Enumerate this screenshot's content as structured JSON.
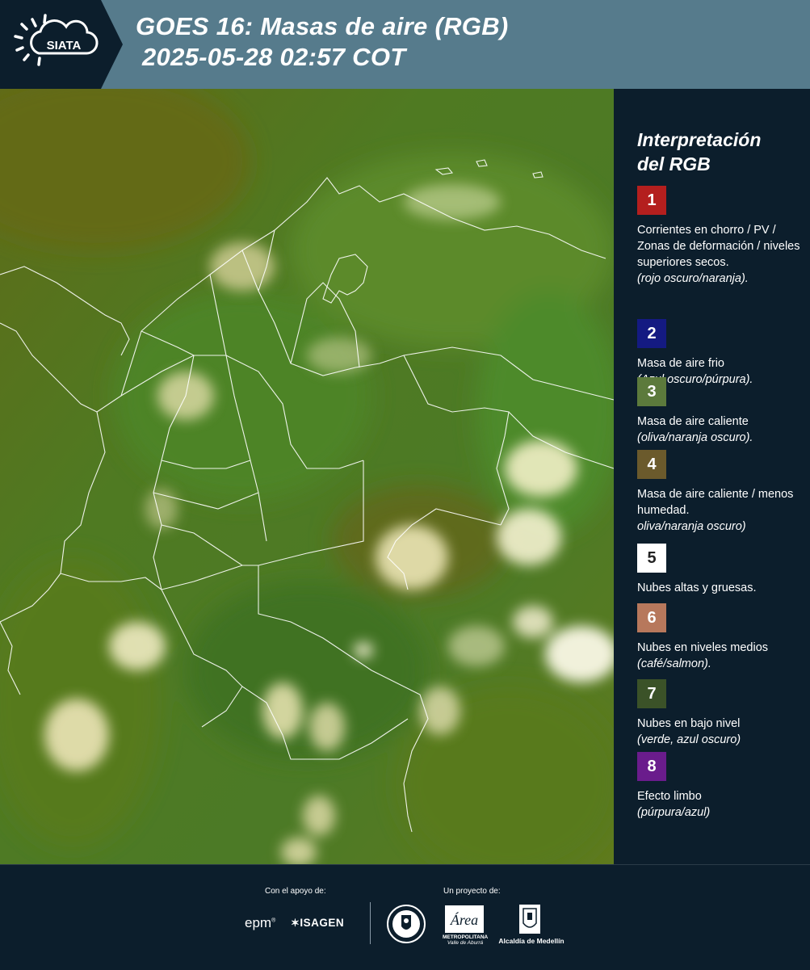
{
  "header": {
    "logo_text": "SIATA",
    "title_line1": "GOES 16: Masas de aire (RGB)",
    "title_line2": "2025-05-28 02:57 COT",
    "background_color": "#567b8c"
  },
  "legend": {
    "title_line1": "Interpretación",
    "title_line2": "del RGB",
    "items": [
      {
        "number": "1",
        "color": "#b41f1e",
        "text": "Corrientes en chorro / PV / Zonas de deformación / niveles superiores secos.",
        "note": "(rojo oscuro/naranja)."
      },
      {
        "number": "2",
        "color": "#141a82",
        "text": "Masa de aire frio",
        "note": "(Azul oscuro/púrpura)."
      },
      {
        "number": "3",
        "color": "#5c7a3c",
        "text": "Masa de aire caliente",
        "note": "(oliva/naranja oscuro)."
      },
      {
        "number": "4",
        "color": "#6b5a2c",
        "text": "Masa de aire caliente / menos humedad.",
        "note": "oliva/naranja oscuro)"
      },
      {
        "number": "5",
        "color": "#ffffff",
        "text": "Nubes altas y gruesas.",
        "note": ""
      },
      {
        "number": "6",
        "color": "#b7785c",
        "text": "Nubes en niveles medios",
        "note": "(café/salmon)."
      },
      {
        "number": "7",
        "color": "#3b5228",
        "text": "Nubes en bajo nivel",
        "note": "(verde, azul oscuro)"
      },
      {
        "number": "8",
        "color": "#6a1c8c",
        "text": "Efecto limbo",
        "note": "(púrpura/azul)"
      }
    ]
  },
  "footer": {
    "support_label": "Con el apoyo de:",
    "project_label": "Un proyecto de:",
    "sponsor1": "epm",
    "sponsor2": "ISAGEN",
    "area_caption": "METROPOLITANA",
    "area_subcaption": "Valle de Aburrá",
    "alcaldia": "Alcaldía de Medellín"
  }
}
